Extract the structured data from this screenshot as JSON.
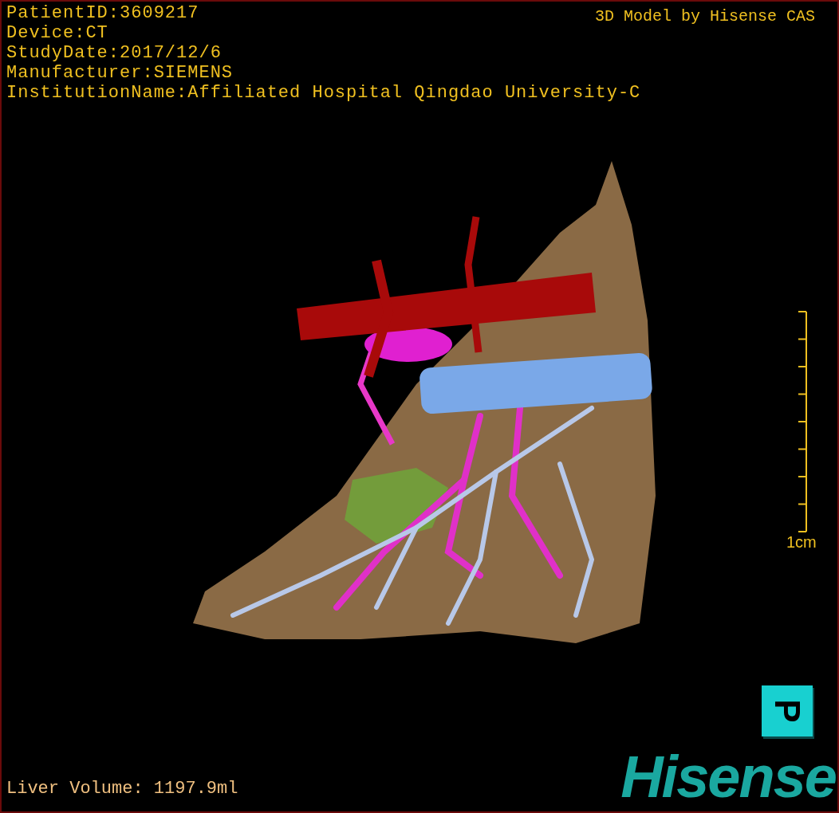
{
  "patient_info": [
    "PatientID:3609217",
    "Device:CT",
    "StudyDate:2017/12/6",
    "Manufacturer:SIEMENS",
    "InstitutionName:Affiliated Hospital Qingdao University-C"
  ],
  "model_credit": "3D Model by Hisense CAS",
  "scale_bar": {
    "label": "1cm"
  },
  "view_button": {
    "label": "P"
  },
  "liver_volume": "Liver Volume: 1197.9ml",
  "logo": "Hisense"
}
